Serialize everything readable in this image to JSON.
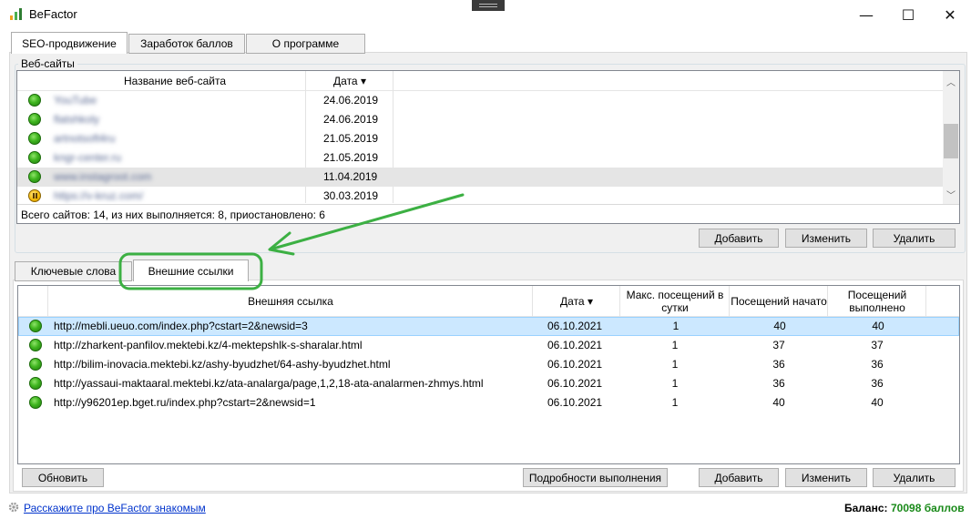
{
  "window": {
    "title": "BeFactor",
    "minimize": "—",
    "maximize": "☐",
    "close": "✕"
  },
  "main_tabs": [
    "SEO-продвижение",
    "Заработок баллов",
    "О программе"
  ],
  "websites": {
    "group_label": "Веб-сайты",
    "columns": {
      "name": "Название веб-сайта",
      "date": "Дата ▾"
    },
    "rows": [
      {
        "name": "YouTube",
        "date": "24.06.2019",
        "status": "green"
      },
      {
        "name": "flatshkoly",
        "date": "24.06.2019",
        "status": "green"
      },
      {
        "name": "artnotsoft4ru",
        "date": "21.05.2019",
        "status": "green"
      },
      {
        "name": "kngr-center.ru",
        "date": "21.05.2019",
        "status": "green"
      },
      {
        "name": "www.instagroot.com",
        "date": "11.04.2019",
        "status": "green"
      },
      {
        "name": "https://v-kruz.com/",
        "date": "30.03.2019",
        "status": "pause"
      }
    ],
    "summary": "Всего сайтов: 14, из них выполняется: 8, приостановлено: 6",
    "buttons": {
      "add": "Добавить",
      "edit": "Изменить",
      "delete": "Удалить"
    }
  },
  "sub_tabs": [
    "Ключевые слова",
    "Внешние ссылки"
  ],
  "links": {
    "columns": {
      "url": "Внешняя ссылка",
      "date": "Дата ▾",
      "max_visits": "Макс. посещений в сутки",
      "started": "Посещений начато",
      "done": "Посещений выполнено"
    },
    "rows": [
      {
        "url": "http://mebli.ueuo.com/index.php?cstart=2&newsid=3",
        "date": "06.10.2021",
        "max": "1",
        "started": "40",
        "done": "40"
      },
      {
        "url": "http://zharkent-panfilov.mektebi.kz/4-mektepshlk-s-sharalar.html",
        "date": "06.10.2021",
        "max": "1",
        "started": "37",
        "done": "37"
      },
      {
        "url": "http://bilim-inovacia.mektebi.kz/ashy-byudzhet/64-ashy-byudzhet.html",
        "date": "06.10.2021",
        "max": "1",
        "started": "36",
        "done": "36"
      },
      {
        "url": "http://yassaui-maktaaral.mektebi.kz/ata-analarga/page,1,2,18-ata-analarmen-zhmys.html",
        "date": "06.10.2021",
        "max": "1",
        "started": "36",
        "done": "36"
      },
      {
        "url": "http://y96201ep.bget.ru/index.php?cstart=2&newsid=1",
        "date": "06.10.2021",
        "max": "1",
        "started": "40",
        "done": "40"
      }
    ],
    "buttons": {
      "refresh": "Обновить",
      "details": "Подробности выполнения",
      "add": "Добавить",
      "edit": "Изменить",
      "delete": "Удалить"
    }
  },
  "footer": {
    "share_link": "Расскажите про BeFactor знакомым",
    "balance_label": "Баланс:",
    "balance_value": "70098 баллов"
  },
  "colors": {
    "accent_green": "#1a8a1a",
    "annotation_green": "#3cb043",
    "link_blue": "#0033cc",
    "selection_blue": "#cce8ff"
  }
}
